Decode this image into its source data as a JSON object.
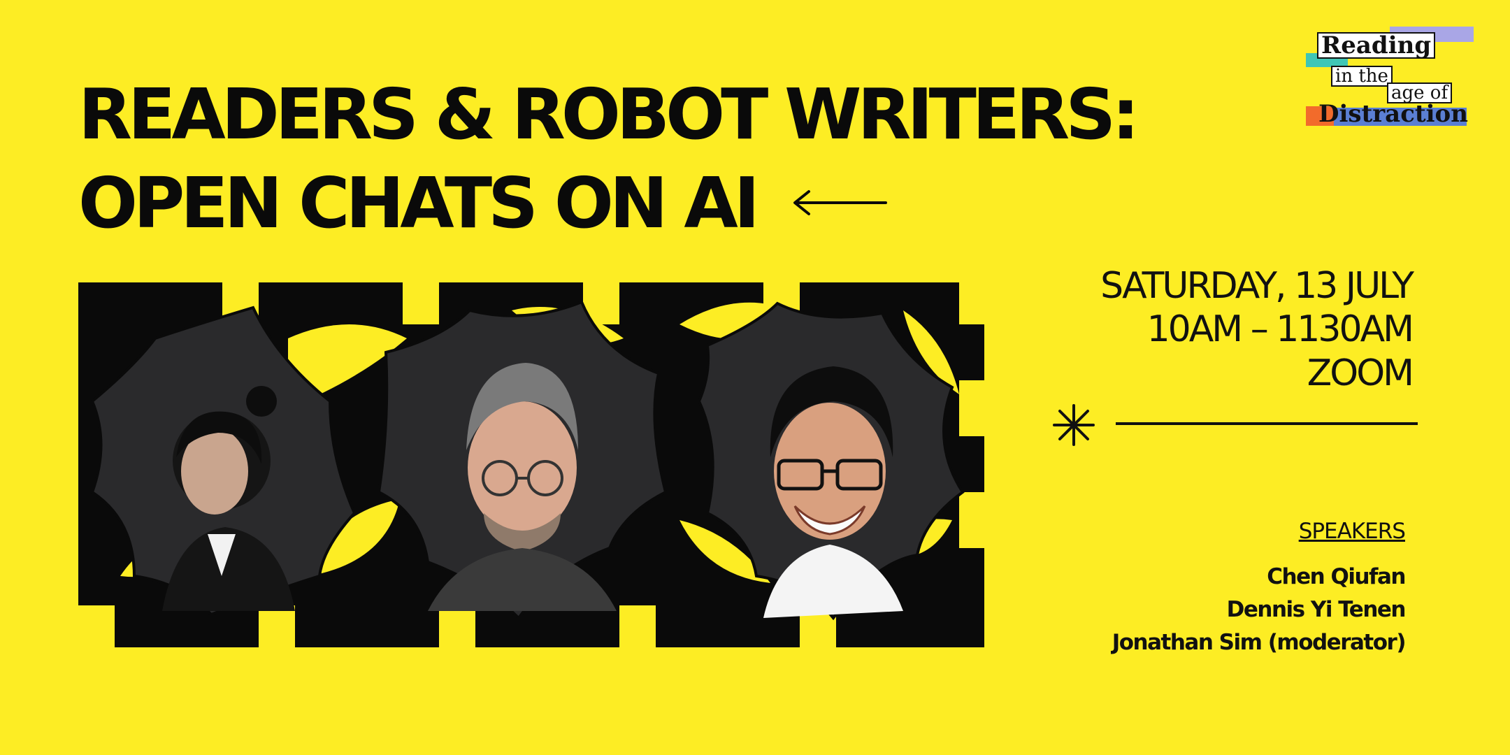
{
  "title": {
    "line1": "READERS & ROBOT WRITERS:",
    "line2": "OPEN CHATS ON AI"
  },
  "icons": {
    "arrow": "arrow-left-icon",
    "asterisk": "asterisk-icon"
  },
  "logo": {
    "word1": "Reading",
    "word2": "in the",
    "word3": "age of",
    "word4": "Distraction",
    "colors": {
      "teal": "#3FC6B5",
      "lavender": "#A9A6E6",
      "orange": "#F26B2B",
      "blue": "#5B7FD3"
    }
  },
  "event": {
    "date": "SATURDAY, 13 JULY",
    "time": "10AM – 1130AM",
    "venue": "ZOOM"
  },
  "speakers": {
    "label": "SPEAKERS",
    "names": [
      "Chen Qiufan",
      "Dennis Yi Tenen",
      "Jonathan Sim (moderator)"
    ]
  },
  "colors": {
    "background": "#FDED24",
    "ink": "#0A0A0A",
    "photo_bg": "#2A2A2C"
  }
}
